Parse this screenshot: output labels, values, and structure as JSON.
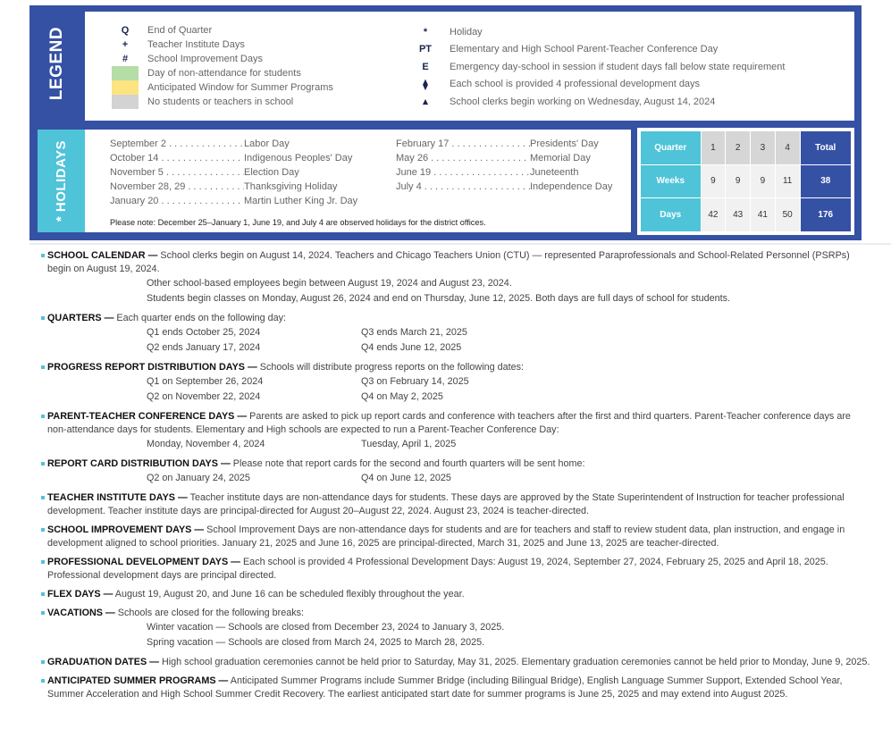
{
  "legend": {
    "title": "LEGEND",
    "left": [
      {
        "symbol": "Q",
        "label": "End of Quarter"
      },
      {
        "symbol": "+",
        "label": "Teacher Institute Days"
      },
      {
        "symbol": "#",
        "label": "School Improvement Days"
      },
      {
        "swatch": "#b5dea6",
        "label": "Day of non-attendance for students"
      },
      {
        "swatch": "#fde480",
        "label": "Anticipated Window for Summer Programs"
      },
      {
        "swatch": "#d3d3d3",
        "label": "No students or teachers in school"
      }
    ],
    "right": [
      {
        "symbol": "*",
        "label": "Holiday"
      },
      {
        "symbol": "PT",
        "label": "Elementary and High School Parent-Teacher Conference Day"
      },
      {
        "symbol": "E",
        "label": "Emergency day-school in session if student days fall below state requirement"
      },
      {
        "symbol": "⧫",
        "label": "Each school is provided 4 professional development days"
      },
      {
        "symbol": "▴",
        "label": "School clerks begin working on Wednesday, August 14, 2024"
      }
    ]
  },
  "holidays": {
    "title": "* HOLIDAYS",
    "col1": [
      {
        "date": "September 2 . . . . . . . . . . . . . . . . . . . .",
        "name": "Labor Day"
      },
      {
        "date": "October 14 . . . . . . . . . . . . . . . . . . . . .",
        "name": "Indigenous Peoples' Day"
      },
      {
        "date": "November 5 . . . . . . . . . . . . . . . . . . . . .",
        "name": "Election Day"
      },
      {
        "date": "November 28, 29 . . . . . . . . . . . . . . . .",
        "name": "Thanksgiving Holiday"
      },
      {
        "date": "January 20 . . . . . . . . . . . . . . . . . . . . . .",
        "name": "Martin Luther King Jr. Day"
      }
    ],
    "col2": [
      {
        "date": "February 17 . . . . . . . . . . . . . . . . . . . .",
        "name": "Presidents' Day"
      },
      {
        "date": "May 26 . . . . . . . . . . . . . . . . . . . . . . . . . .",
        "name": "Memorial Day"
      },
      {
        "date": "June 19 . . . . . . . . . . . . . . . . . . . . . . . . .",
        "name": "Juneteenth"
      },
      {
        "date": "July 4 . . . . . . . . . . . . . . . . . . . . . . . . . . .",
        "name": "Independence Day"
      }
    ],
    "note": "Please note: December 25–January 1, June 19, and July 4 are observed holidays for the district offices."
  },
  "stats": {
    "header": {
      "label": "Quarter",
      "quarters": [
        "1",
        "2",
        "3",
        "4"
      ],
      "total": "Total"
    },
    "rows": [
      {
        "label": "Weeks",
        "values": [
          "9",
          "9",
          "9",
          "11"
        ],
        "total": "38"
      },
      {
        "label": "Days",
        "values": [
          "42",
          "43",
          "41",
          "50"
        ],
        "total": "176"
      }
    ]
  },
  "notes": [
    {
      "title": "SCHOOL CALENDAR —",
      "text": " School clerks begin on August 14, 2024. Teachers and Chicago Teachers Union (CTU) — represented Paraprofessionals and School-Related Personnel (PSRPs) begin on August 19, 2024.",
      "subs": [
        "Other school-based employees begin between August 19, 2024 and August 23, 2024.",
        "Students begin classes on Monday, August 26, 2024 and end on Thursday, June 12, 2025. Both days are full days of school for students."
      ]
    },
    {
      "title": "QUARTERS —",
      "text": " Each quarter ends on the following day:",
      "pairs": [
        [
          "Q1 ends October 25, 2024",
          "Q3 ends March 21, 2025"
        ],
        [
          "Q2 ends January 17, 2024",
          "Q4 ends June 12, 2025"
        ]
      ]
    },
    {
      "title": "PROGRESS REPORT DISTRIBUTION DAYS —",
      "text": " Schools will distribute progress reports on the following dates:",
      "pairs": [
        [
          "Q1 on September 26, 2024",
          "Q3 on February 14, 2025"
        ],
        [
          "Q2 on November 22, 2024",
          "Q4 on May 2, 2025"
        ]
      ]
    },
    {
      "title": "PARENT-TEACHER CONFERENCE DAYS —",
      "text": " Parents are asked to pick up report cards and conference with teachers after the first and third quarters. Parent-Teacher conference days are non-attendance days for students. Elementary and High schools are expected to run a Parent-Teacher Conference Day:",
      "pairs": [
        [
          "Monday, November 4, 2024",
          "Tuesday, April 1, 2025"
        ]
      ]
    },
    {
      "title": "REPORT CARD DISTRIBUTION DAYS —",
      "text": " Please note that report cards for the second and fourth quarters will be sent home:",
      "pairs": [
        [
          "Q2 on January 24, 2025",
          "Q4 on June 12, 2025"
        ]
      ]
    },
    {
      "title": "TEACHER INSTITUTE DAYS —",
      "text": " Teacher institute days are non-attendance days for students. These days are approved by the State Superintendent of Instruction for teacher professional development. Teacher institute days are principal-directed for August 20–August 22, 2024. August 23, 2024 is teacher-directed."
    },
    {
      "title": "SCHOOL IMPROVEMENT DAYS —",
      "text": " School Improvement Days are non-attendance days for students and are for teachers and staff to review student data, plan instruction, and engage in development aligned to school priorities. January 21, 2025 and June 16, 2025 are principal-directed, March 31, 2025 and June 13, 2025 are teacher-directed."
    },
    {
      "title": "PROFESSIONAL DEVELOPMENT DAYS —",
      "text": " Each school is provided 4 Professional Development Days: August 19, 2024, September 27, 2024, February 25, 2025 and April 18, 2025. Professional development days are principal directed."
    },
    {
      "title": "FLEX DAYS —",
      "text": " August 19, August 20, and June 16 can be scheduled flexibly throughout the year."
    },
    {
      "title": "VACATIONS —",
      "text": " Schools are closed for the following breaks:",
      "subs": [
        "Winter vacation — Schools are closed from December 23, 2024 to January 3, 2025.",
        "Spring vacation — Schools are closed from March 24, 2025 to March 28, 2025."
      ]
    },
    {
      "title": "GRADUATION DATES —",
      "text": " High school graduation ceremonies cannot be held prior to Saturday, May 31, 2025. Elementary graduation ceremonies cannot be held prior to Monday, June 9, 2025."
    },
    {
      "title": "ANTICIPATED SUMMER PROGRAMS —",
      "text": " Anticipated Summer Programs include Summer Bridge (including Bilingual Bridge), English Language Summer Support, Extended School Year, Summer Acceleration and High School Summer Credit Recovery. The earliest anticipated start date for summer programs is June 25, 2025 and may extend into August 2025."
    }
  ]
}
